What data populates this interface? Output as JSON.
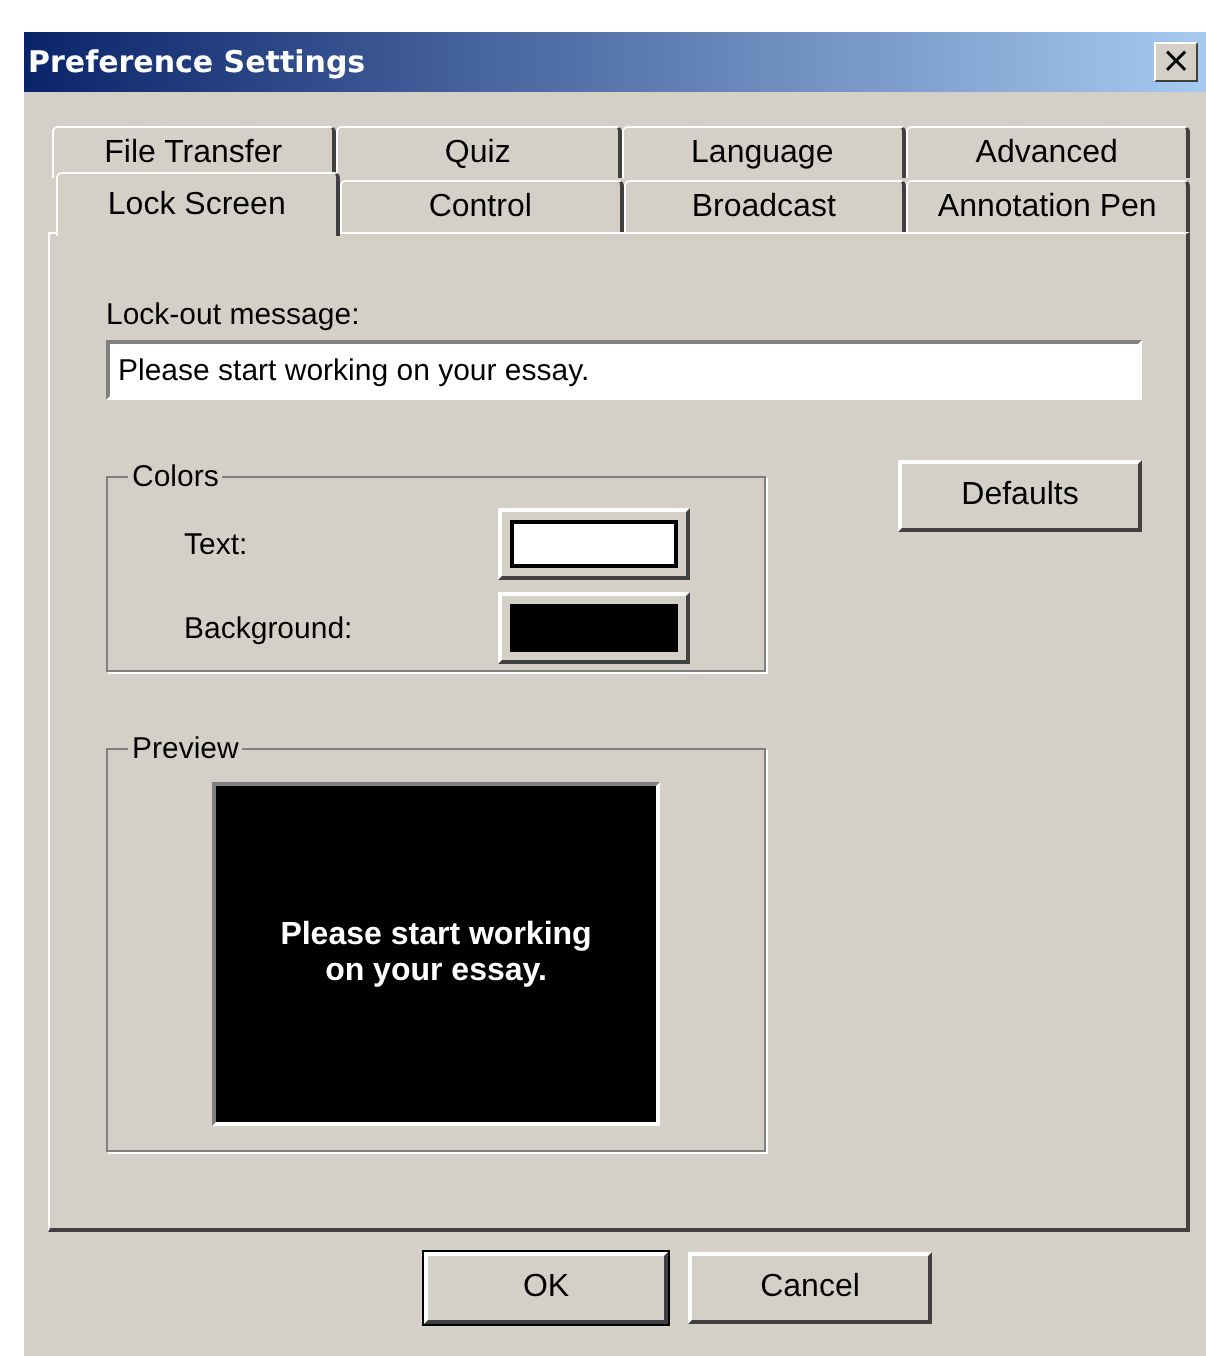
{
  "window": {
    "title": "Preference Settings",
    "close": "×"
  },
  "tab_rows": [
    [
      {
        "label": "File Transfer",
        "selected": false
      },
      {
        "label": "Quiz",
        "selected": false
      },
      {
        "label": "Language",
        "selected": false
      },
      {
        "label": "Advanced",
        "selected": false
      }
    ],
    [
      {
        "label": "Lock Screen",
        "selected": true
      },
      {
        "label": "Control",
        "selected": false
      },
      {
        "label": "Broadcast",
        "selected": false
      },
      {
        "label": "Annotation Pen",
        "selected": false
      }
    ]
  ],
  "lockout": {
    "label": "Lock-out message:",
    "value": "Please start working on your essay."
  },
  "colors": {
    "title": "Colors",
    "items": [
      {
        "label": "Text:",
        "color": "#ffffff"
      },
      {
        "label": "Background:",
        "color": "#000000"
      }
    ]
  },
  "defaults_button": "Defaults",
  "preview": {
    "title": "Preview",
    "text": "Please start working on your essay."
  },
  "buttons": [
    {
      "label": "OK",
      "default": true
    },
    {
      "label": "Cancel",
      "default": false
    }
  ]
}
